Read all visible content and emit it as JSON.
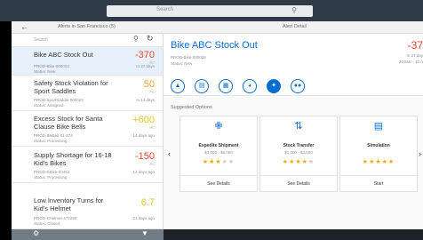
{
  "topbar": {
    "search_placeholder": "Search"
  },
  "subheader": {
    "list_title": "Alerts in San Francisco (5)",
    "detail_title": "Alert Detail"
  },
  "list": {
    "search_label": "Search",
    "items": [
      {
        "title": "Bike ABC Stock Out",
        "value": "-370",
        "unit": "PC",
        "meta1": "PROD-Bike-000023",
        "meta2": "Status: New",
        "time": "In 27 days"
      },
      {
        "title": "Safety Stock Violation for Sport Saddles",
        "value": "50",
        "unit": "PC",
        "meta1": "PROD-SportSaddle-000023",
        "meta2": "Status: Assigned",
        "time": "In 14 days"
      },
      {
        "title": "Excess Stock for Santa Clause Bike Bells",
        "value": "+600",
        "unit": "PC",
        "meta1": "PROD-BlkBell-01-874",
        "meta2": "Status: Processing",
        "time": "14 days ago"
      },
      {
        "title": "Supply Shortage for 16-18 Kid's Bikes",
        "value": "-150",
        "unit": "PC",
        "meta1": "PROD-KBike-00453",
        "meta2": "Status: Processing",
        "time": "14 days ago"
      },
      {
        "title": "Low Inventory Turns for Kid's Helmet",
        "value": "6.7",
        "unit": "",
        "meta1": "PROD-KHelmet-472290",
        "meta2": "Status: Closed",
        "time": "21 days ago"
      }
    ]
  },
  "detail": {
    "title": "Bike ABC Stock Out",
    "meta1": "PROD-Bike-000023",
    "meta2": "Status: New",
    "value": "-37",
    "side1": "In 27 day",
    "side2": "20 Mar - 10 A",
    "section_title": "Suggested Options",
    "cards": [
      {
        "title": "Expedite Shipment",
        "range": "$3,000 - $5,000",
        "rating": 3,
        "action": "See Details",
        "icon": "truck-icon"
      },
      {
        "title": "Stock Transfer",
        "range": "$1,000 - $3,500",
        "rating": 4,
        "action": "See Details",
        "icon": "transfer-icon"
      },
      {
        "title": "Simulation",
        "range": "",
        "rating": 5,
        "action": "Start",
        "icon": "simulation-icon"
      }
    ]
  },
  "colors": {
    "accent": "#0a6ed1",
    "negative": "#e8442a",
    "warning": "#f2a52b",
    "header": "#2f3c48"
  }
}
